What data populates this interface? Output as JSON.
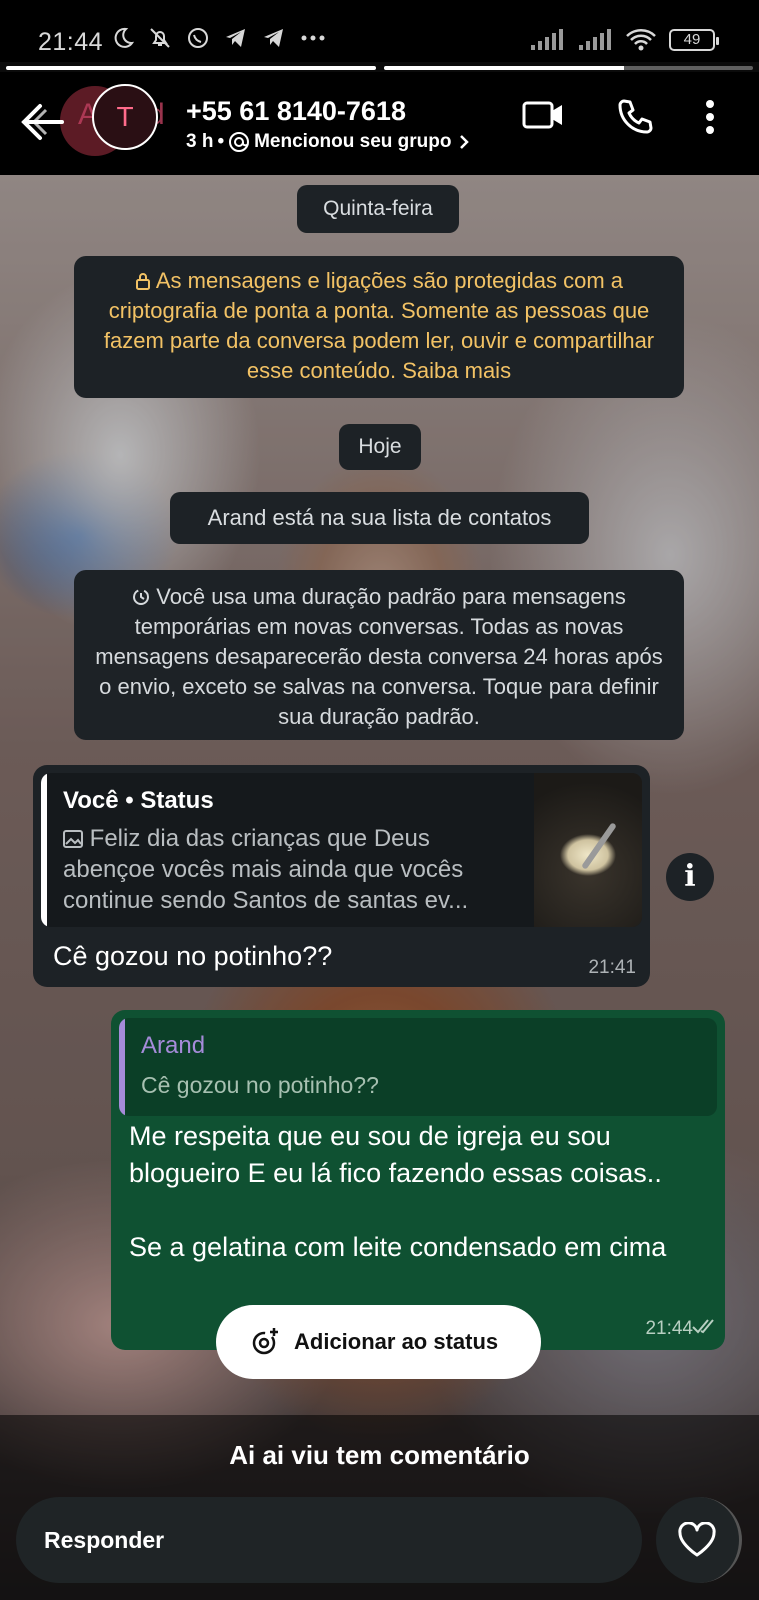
{
  "status_bar": {
    "time": "21:44",
    "battery": "49",
    "icons": [
      "moon-icon",
      "mute-icon",
      "whatsapp-icon",
      "telegram-icon",
      "telegram-icon",
      "more-dots-icon",
      "signal-icon",
      "signal-icon",
      "wifi-icon",
      "battery-icon"
    ]
  },
  "story": {
    "progress": [
      1.0,
      0.65
    ],
    "ghost_text": "A  rand",
    "avatar_initial": "T",
    "phone": "+55 61 8140-7618",
    "meta_time": "3 h",
    "meta_sep": "•",
    "meta_label": "Mencionou seu grupo",
    "caption": "Ai ai viu tem comentário",
    "add_status": "Adicionar ao status",
    "reply_placeholder": "Responder"
  },
  "chat": {
    "date_1": "Quinta-feira",
    "encryption_notice": "As mensagens e ligações são protegidas com a criptografia de ponta a ponta. Somente as pessoas que fazem parte da conversa podem ler, ouvir e compartilhar esse conteúdo. Saiba mais",
    "date_2": "Hoje",
    "contact_notice": "Arand está na sua lista de contatos",
    "disappearing_notice": "Você usa uma duração padrão para mensagens temporárias em novas conversas. Todas as novas mensagens desaparecerão desta conversa 24 horas após o envio, exceto se salvas na conversa. Toque para definir sua duração padrão.",
    "incoming": {
      "quote_title": "Você • Status",
      "quote_text": "Feliz dia das crianças que Deus abençoe vocês mais ainda que vocês continue sendo Santos de santas ev...",
      "text": "Cê gozou no potinho??",
      "time": "21:41"
    },
    "outgoing": {
      "quote_title": "Arand",
      "quote_text": "Cê gozou no potinho??",
      "text_line1": "Me respeita que eu sou de igreja eu sou blogueiro E eu lá fico fazendo essas coisas..",
      "text_line2": "Se a gelatina com leite condensado em cima",
      "time": "21:44"
    }
  }
}
